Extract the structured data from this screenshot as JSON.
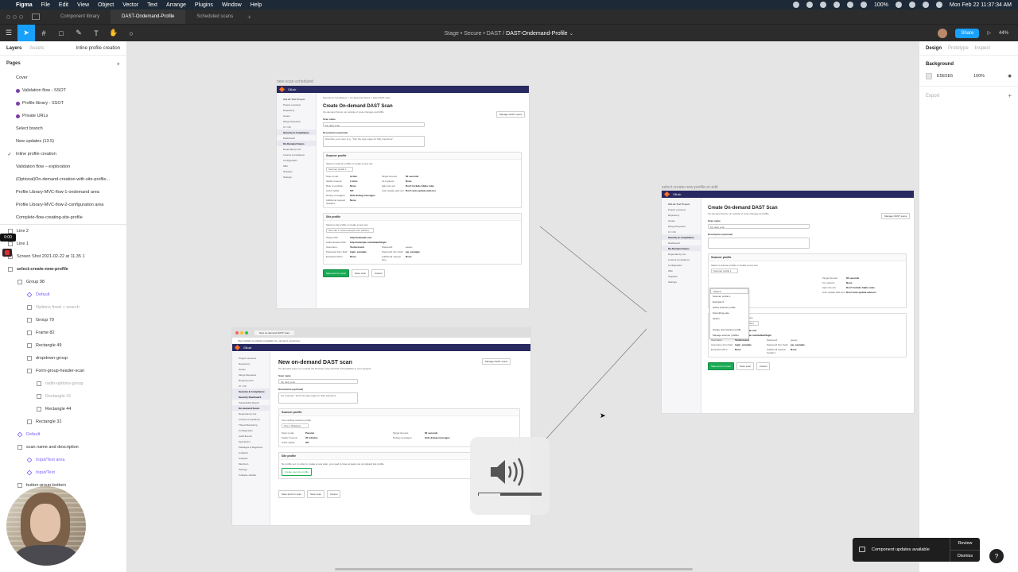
{
  "menubar": {
    "app": "Figma",
    "items": [
      "File",
      "Edit",
      "View",
      "Object",
      "Vector",
      "Text",
      "Arrange",
      "Plugins",
      "Window",
      "Help"
    ],
    "battery": "100%",
    "datetime": "Mon Feb 22  11:37:34 AM"
  },
  "tabs": [
    {
      "label": "Component library",
      "active": false
    },
    {
      "label": "DAST-Ondemand-Profile",
      "active": true
    },
    {
      "label": "Scheduled scans",
      "active": false
    }
  ],
  "toolbar": {
    "breadcrumb": "Stage • Secure • DAST",
    "file": "DAST-Ondemand-Profile",
    "share": "Share",
    "zoom": "44%"
  },
  "left_panel": {
    "tabs": {
      "layers": "Layers",
      "assets": "Assets",
      "page_selector": "Inline profile creation"
    },
    "pages_title": "Pages",
    "pages": [
      {
        "label": "Cover",
        "dot": false
      },
      {
        "label": "Validation flow - SSOT",
        "dot": true
      },
      {
        "label": "Profile library - SSOT",
        "dot": true
      },
      {
        "label": "Private URLs",
        "dot": true
      },
      {
        "label": "Select branch",
        "dot": false
      },
      {
        "label": "New updates (13.5)",
        "dot": false
      },
      {
        "label": "Inline profile creation",
        "dot": false,
        "checked": true
      },
      {
        "label": "Validation flow – exploration",
        "dot": false
      },
      {
        "label": "(Optional)On-demand-creation-with-site-profile...",
        "dot": false
      },
      {
        "label": "Profile Library-MVC-flow-1-ondemand area",
        "dot": false
      },
      {
        "label": "Profile Library-MVC-flow-2-configuration area",
        "dot": false
      },
      {
        "label": "Complete-flow-creating-site-profile",
        "dot": false
      }
    ],
    "recording_time": "0:00",
    "layers": [
      {
        "label": "Line 2",
        "indent": 20,
        "style": "normal"
      },
      {
        "label": "Line 1",
        "indent": 20,
        "style": "normal"
      },
      {
        "label": "Screen Shot 2021-02-22 at 11.35 1",
        "indent": 20,
        "style": "normal"
      },
      {
        "label": "select-create-new-profile",
        "indent": 20,
        "style": "bold"
      },
      {
        "label": "Group 98",
        "indent": 32,
        "style": "normal"
      },
      {
        "label": "Default",
        "indent": 44,
        "style": "purple"
      },
      {
        "label": "Options fixed + search",
        "indent": 44,
        "style": "muted"
      },
      {
        "label": "Group 79",
        "indent": 44,
        "style": "normal"
      },
      {
        "label": "Frame 82",
        "indent": 44,
        "style": "normal"
      },
      {
        "label": "Rectangle 49",
        "indent": 44,
        "style": "normal"
      },
      {
        "label": "dropdown-group",
        "indent": 44,
        "style": "normal"
      },
      {
        "label": "Form-group-header-scan",
        "indent": 44,
        "style": "normal"
      },
      {
        "label": "radio-options-group",
        "indent": 56,
        "style": "muted"
      },
      {
        "label": "Rectangle 41",
        "indent": 56,
        "style": "muted"
      },
      {
        "label": "Rectangle 44",
        "indent": 56,
        "style": "normal"
      },
      {
        "label": "Rectangle 32",
        "indent": 44,
        "style": "normal"
      },
      {
        "label": "Default",
        "indent": 32,
        "style": "purple"
      },
      {
        "label": "scan name and description",
        "indent": 32,
        "style": "normal"
      },
      {
        "label": "Input/Text area",
        "indent": 44,
        "style": "purple"
      },
      {
        "label": "Input/Text",
        "indent": 44,
        "style": "purple"
      },
      {
        "label": "button-group-bottom",
        "indent": 32,
        "style": "normal"
      }
    ],
    "bottom_fragments": [
      "can",
      "topbar"
    ]
  },
  "canvas": {
    "frame1": {
      "label": "new-scan-scheduled",
      "project": "GitLab Test Project",
      "breadcrumb": "Security & Compliance  >  On-Demand Scans  >  New DAST scan",
      "title": "Create On-demand DAST Scan",
      "subtitle": "On-demand Scans run outside of code changes and MRs.",
      "manage": "Manage DAST scans",
      "scan_name": "Scan name",
      "scan_name_ph": "My daily scan",
      "description": "Description (optional)",
      "description_ph": "Describe your scan. E.g. \"Test the login page for SQL injections\".",
      "scanner_profile": "Scanner profile",
      "scanner_help": "Select a scanner profile or create a new one",
      "scanner_select": "Scanner profile 1",
      "scanner_kv": [
        [
          "Scan mode:",
          "Active",
          "Target timeout:",
          "60 seconds"
        ],
        [
          "Spider timeout:",
          "1 mins",
          "CLI options:",
          "None"
        ],
        [
          "Rule to exclude:",
          "None",
          "Ajax rule set:",
          "Don't include Alpha rules"
        ],
        [
          "AJAX spider:",
          "Off",
          "Auto update add-ons:",
          "Don't auto update add-ons"
        ],
        [
          "Debug messages:",
          "Hide debug messages",
          "",
          ""
        ],
        [
          "Additional request headers:",
          "None",
          "",
          ""
        ]
      ],
      "site_profile": "Site profile",
      "site_help": "Select a site profile or create a new one",
      "site_select": "Test site 1: www.example.com (active)",
      "site_kv": [
        [
          "Target URL:",
          "http://example.com",
          "",
          ""
        ],
        [
          "Authenticated URL:",
          "http://example.com/default/login",
          "",
          ""
        ],
        [
          "Username:",
          "TestAccount",
          "Password:",
          "••••••••"
        ],
        [
          "Password form field:",
          "login_example",
          "Password form field:",
          "pw_example"
        ],
        [
          "Excluded URLs:",
          "None",
          "Additional request hea...",
          "None"
        ]
      ],
      "buttons": [
        "Save and run scan",
        "Save scan",
        "Cancel"
      ],
      "nav": [
        "Project overview",
        "Repository",
        "Issues",
        "Merge Requests",
        "CI / CD",
        "Security & Compliance",
        "Dashboard",
        "On-Demand Scans",
        "Dependency List",
        "License Compliance",
        "Configuration",
        "Wiki",
        "Snippets",
        "Settings"
      ]
    },
    "frame2": {
      "label": "select-create-new-profile-or-edit",
      "project": "GitLab Test Project",
      "title": "Create On-demand DAST Scan",
      "subtitle": "On-demand Scans run outside of code changes and MRs.",
      "manage": "Manage DAST scans",
      "scan_name": "Scan name",
      "scan_name_ph": "My daily scan",
      "description": "Description (optional)",
      "scanner_profile": "Scanner profile",
      "scanner_help": "Select a scanner profile or create a new one",
      "scanner_select": "Scanner profile 1",
      "dropdown": [
        "Search",
        "Scanner profile 1",
        "Example 6",
        "Active scanner profile",
        "Something else",
        "Option",
        "",
        "Create new scanner profile",
        "Manage scanner profiles"
      ],
      "scanner_kv": [
        [
          "",
          "",
          "Target timeout:",
          "60 seconds"
        ],
        [
          "",
          "",
          "CLI options:",
          "None"
        ],
        [
          "",
          "",
          "Ajax rule set:",
          "Don't include Alpha rules"
        ],
        [
          "",
          "",
          "Auto update add-ons:",
          "Don't auto update add-ons"
        ]
      ],
      "site_help": "Select a site profile or create a new one",
      "site_select": "Test site 1: www.example.com (active)",
      "site_kv": [
        [
          "Target URL:",
          "http://example.com",
          "",
          ""
        ],
        [
          "Authenticated URL:",
          "http://example.com/default/login",
          "",
          ""
        ],
        [
          "Username:",
          "TestAccount",
          "Password:",
          "••••••••"
        ],
        [
          "Username form field:",
          "login_example",
          "Password form field:",
          "pw_example"
        ],
        [
          "Excluded URLs:",
          "None",
          "Additional request headers:",
          "None"
        ]
      ],
      "buttons": [
        "Save and run scan",
        "Save scan",
        "Cancel"
      ],
      "nav": [
        "Project overview",
        "Repository",
        "Issues",
        "Merge Requests",
        "CI / CD",
        "Security & Compliance",
        "Dashboard",
        "On-Demand Scans",
        "Dependency List",
        "License Compliance",
        "Configuration",
        "Wiki",
        "Snippets",
        "Settings"
      ]
    },
    "frame3": {
      "url": "https://gitlab.com/gitlab-org/gitlab/-/on_demand_scans/new",
      "tab_title": "New on-demand DAST scan",
      "title": "New on-demand DAST scan",
      "subtitle": "On-demand scans run outside the DevOps cycle and find vulnerabilities in your projects.",
      "manage": "Manage DAST scans",
      "scan_name": "Scan name",
      "scan_name_ph": "My daily scan",
      "description": "Description (optional)",
      "description_ph": "For example: Tests the login page for SQL injections",
      "scanner_profile": "Scanner profile",
      "scanner_help": "Use existing scanner profile",
      "scanner_select": "Test 1 (Passive)",
      "scanner_kv": [
        [
          "Scan mode:",
          "Passive",
          "Target timeout:",
          "60 seconds"
        ],
        [
          "Spider timeout:",
          "20 minutes",
          "Debug messages:",
          "Hide debug messages"
        ],
        [
          "AJAX spider:",
          "Off",
          "",
          ""
        ]
      ],
      "site_profile": "Site profile",
      "site_help": "No profile yet. In order to create a new scan, you need to have at least one completed site profile.",
      "site_button": "Create new site profile",
      "buttons": [
        "Save and run scan",
        "Save scan",
        "Cancel"
      ],
      "nav": [
        "Project overview",
        "Repository",
        "Issues",
        "Merge Requests",
        "Requirements",
        "CI / CD",
        "Security & Compliance",
        "Security Dashboard",
        "Vulnerability Report",
        "On-demand Scans",
        "Dependency List",
        "License Compliance",
        "Threat Monitoring",
        "Configuration",
        "Audit Events",
        "Operations",
        "Packages & Registries",
        "Analytics",
        "Snippets",
        "Members",
        "Settings",
        "Collapse sidebar"
      ],
      "badges": {
        "issues": "38,580",
        "mrs": "1,234"
      }
    }
  },
  "volume": {
    "level": 0.35
  },
  "right_panel": {
    "tabs": [
      "Design",
      "Prototype",
      "Inspect"
    ],
    "background_title": "Background",
    "bg_hex": "E5E5E5",
    "bg_opacity": "100%",
    "export_title": "Export"
  },
  "toast": {
    "message": "Component updates available",
    "review": "Review",
    "dismiss": "Dismiss"
  },
  "colors": {
    "figma_blue": "#18a0fb",
    "gitlab_nav": "#292961",
    "gitlab_orange": "#fc6d26",
    "gitlab_green": "#1aaa55"
  }
}
